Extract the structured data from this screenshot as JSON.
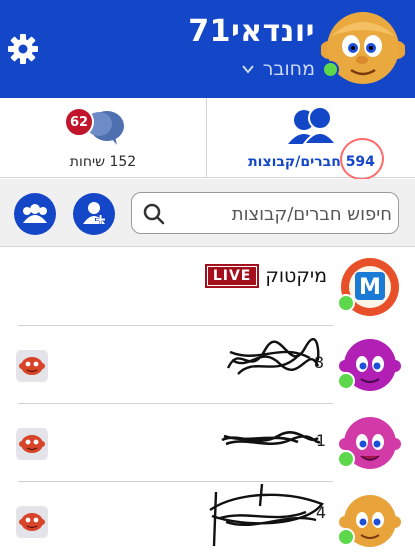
{
  "header": {
    "username": "יונדאי71",
    "status": "מחובר",
    "colors": {
      "bar": "#1446c8",
      "online": "#5dd84d"
    },
    "icons": {
      "settings": "gear-icon",
      "status_dropdown": "chevron-down-icon"
    }
  },
  "tabs": {
    "friends": {
      "label": "594 חברים/קבוצות",
      "icon": "friends-icon"
    },
    "chats": {
      "label": "152 שיחות",
      "badge": "62",
      "icon": "chat-bubbles-icon"
    }
  },
  "search": {
    "placeholder": "חיפוש חברים/קבוצות",
    "value": "",
    "icons": {
      "search": "search-icon",
      "add": "add-friend-icon",
      "groups": "groups-icon"
    }
  },
  "list": {
    "items": [
      {
        "name": "מיקטוק",
        "live": "LIVE",
        "online": true,
        "avatar": "miktok-logo",
        "color": "#e8502a"
      },
      {
        "name": "",
        "online": true,
        "avatar": "purple-character",
        "color": "#b21fb5"
      },
      {
        "name": "",
        "online": true,
        "avatar": "pink-character",
        "color": "#d23aa8"
      },
      {
        "name": "",
        "online": true,
        "avatar": "orange-character",
        "color": "#e8a43a"
      }
    ]
  }
}
